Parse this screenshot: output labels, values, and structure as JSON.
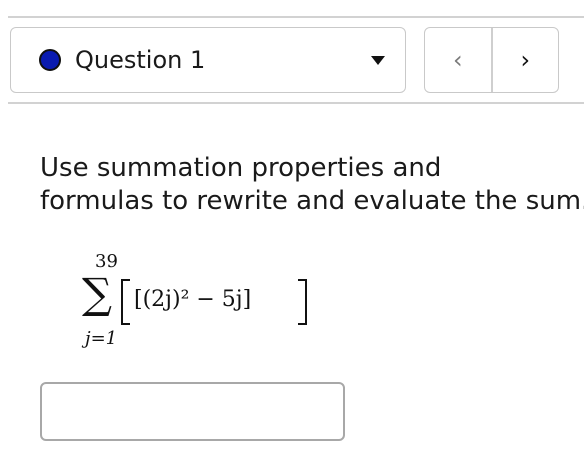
{
  "question_selector": {
    "label": "Question 1",
    "status_color": "#0a1bb0"
  },
  "navigation": {
    "prev_glyph": "‹",
    "next_glyph": "›"
  },
  "prompt": {
    "line1": "Use summation properties and",
    "line2": "formulas to rewrite and evaluate the sum."
  },
  "formula": {
    "upper_limit": "39",
    "lower_limit": "j=1",
    "summand": "[(2j)² − 5j]"
  },
  "answer": {
    "value": "",
    "placeholder": ""
  }
}
